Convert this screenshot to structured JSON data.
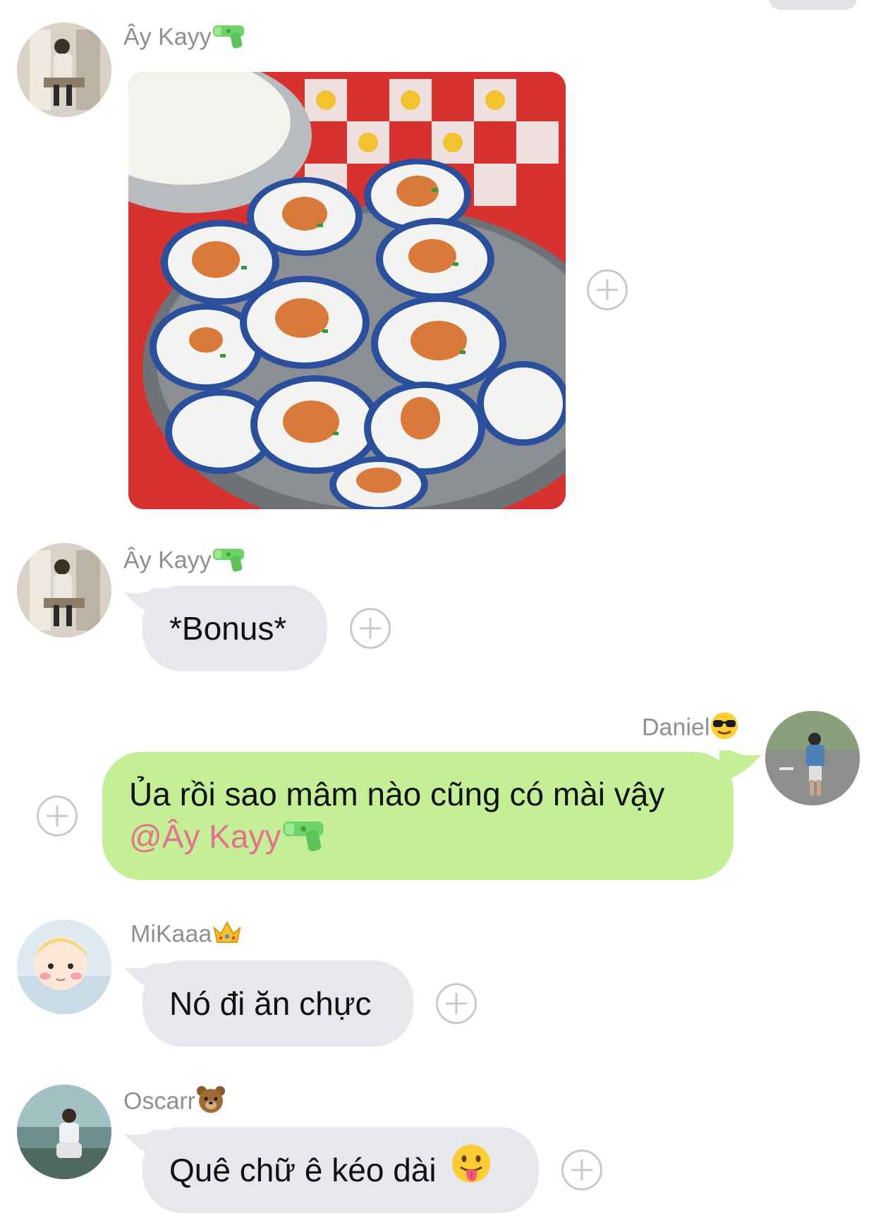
{
  "messages": [
    {
      "sender": "Ây Kayy",
      "sender_badge": "water-pistol-icon",
      "type": "image",
      "image_description_icon": "banh-beo-photo"
    },
    {
      "sender": "Ây Kayy",
      "sender_badge": "water-pistol-icon",
      "type": "text",
      "text": "*Bonus*"
    },
    {
      "sender": "Daniel",
      "sender_badge": "sunglasses-face-icon",
      "type": "text",
      "outgoing": true,
      "text": "Ủa rồi sao mâm nào cũng có mài vậy",
      "mention": "@Ây Kayy",
      "mention_badge": "water-pistol-icon"
    },
    {
      "sender": "MiKaaa",
      "sender_badge": "crown-icon",
      "type": "text",
      "text": "Nó đi ăn chực"
    },
    {
      "sender": "Oscarr",
      "sender_badge": "bear-face-icon",
      "type": "text",
      "text": "Quê chữ ê kéo dài",
      "trailing_emoji": "tongue-face-icon"
    }
  ],
  "colors": {
    "incoming_bubble": "#e7e8ec",
    "outgoing_bubble": "#c5ef97",
    "mention": "#e4728f",
    "sender_name": "#8e8e93"
  }
}
